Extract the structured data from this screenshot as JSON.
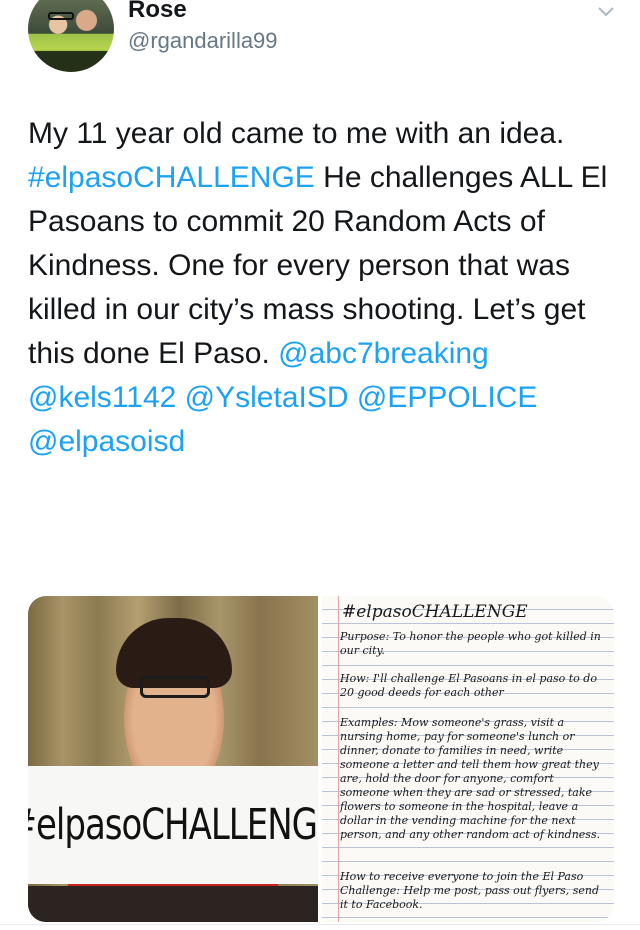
{
  "user": {
    "display_name": "Rose",
    "handle": "@rgandarilla99"
  },
  "tweet": {
    "segments": [
      {
        "text": "My 11 year old came to me with an idea. ",
        "link": false
      },
      {
        "text": "#elpasoCHALLENGE",
        "link": true
      },
      {
        "text": " He challenges ALL El Pasoans to commit 20 Random Acts of Kindness. One for every person that was killed in our city’s mass shooting. Let’s get this done El Paso. ",
        "link": false
      },
      {
        "text": "@abc7breaking",
        "link": true
      },
      {
        "text": " ",
        "link": false
      },
      {
        "text": "@kels1142",
        "link": true
      },
      {
        "text": " ",
        "link": false
      },
      {
        "text": "@YsletaISD",
        "link": true
      },
      {
        "text": " ",
        "link": false
      },
      {
        "text": "@EPPOLICE",
        "link": true
      },
      {
        "text": " ",
        "link": false
      },
      {
        "text": "@elpasoisd",
        "link": true
      }
    ]
  },
  "media": {
    "sign_text": "#elpasoCHALLENGE",
    "note": {
      "title": "#elpasoCHALLENGE",
      "purpose": "Purpose: To honor the people who got killed in our city.",
      "how": "How: I'll challenge El Pasoans in el paso to do 20 good deeds for each other",
      "examples": "Examples: Mow someone's grass, visit a nursing home, pay for someone's lunch or dinner, donate to families in need, write someone a letter and tell them how great they are, hold the door for anyone, comfort someone when they are sad or stressed, take flowers to someone in the hospital, leave a dollar in the vending machine for the next person, and any other random act of kindness.",
      "closing": "How to receive everyone to join the El Paso Challenge: Help me post, pass out flyers, send it to Facebook."
    },
    "colors": {
      "link": "#1da1f2",
      "shirt": "#c8231f"
    }
  }
}
